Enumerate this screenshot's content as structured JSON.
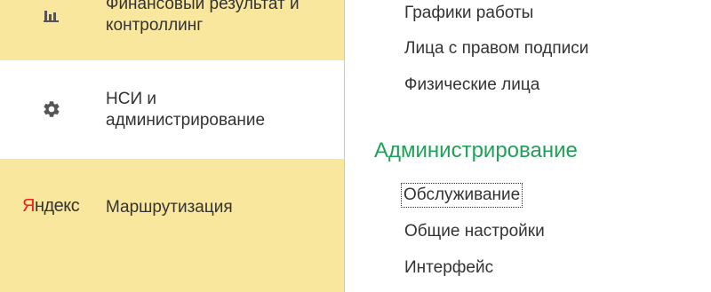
{
  "sidebar": {
    "sections": [
      {
        "label": "Финансовый результат и контроллинг",
        "icon": "bar-chart-icon"
      },
      {
        "label": "НСИ и администрирование",
        "icon": "gear-icon"
      },
      {
        "label": "Маршрутизация",
        "icon": "yandex-logo"
      }
    ],
    "yandex_logo_text": "Яндекс"
  },
  "content": {
    "links_top": [
      "Графики работы",
      "Лица с правом подписи",
      "Физические лица"
    ],
    "admin_heading": "Администрирование",
    "admin_links": [
      "Обслуживание",
      "Общие настройки",
      "Интерфейс"
    ]
  },
  "colors": {
    "sidebar_bg": "#f9e79d",
    "heading_green": "#21a05a",
    "yandex_red": "#e52620"
  }
}
